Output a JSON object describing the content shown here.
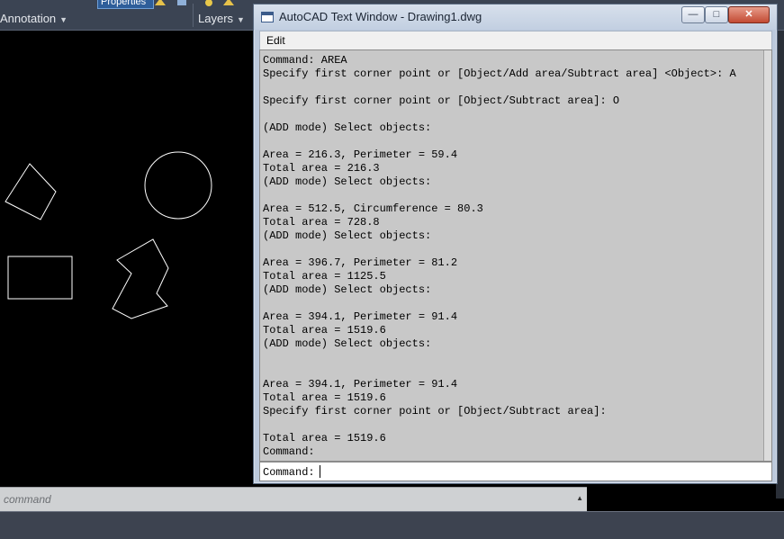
{
  "ribbon": {
    "annotation_label": "Annotation",
    "layers_label": "Layers",
    "properties_button": "Properties",
    "dropdown_caret": "▼"
  },
  "text_window": {
    "title": "AutoCAD Text Window - Drawing1.dwg",
    "minimize_glyph": "—",
    "maximize_glyph": "□",
    "close_glyph": "✕",
    "menu": {
      "edit_label": "Edit"
    },
    "lines": [
      "Command: AREA",
      "Specify first corner point or [Object/Add area/Subtract area] <Object>: A",
      "",
      "Specify first corner point or [Object/Subtract area]: O",
      "",
      "(ADD mode) Select objects:",
      "",
      "Area = 216.3, Perimeter = 59.4",
      "Total area = 216.3",
      "(ADD mode) Select objects:",
      "",
      "Area = 512.5, Circumference = 80.3",
      "Total area = 728.8",
      "(ADD mode) Select objects:",
      "",
      "Area = 396.7, Perimeter = 81.2",
      "Total area = 1125.5",
      "(ADD mode) Select objects:",
      "",
      "Area = 394.1, Perimeter = 91.4",
      "Total area = 1519.6",
      "(ADD mode) Select objects:",
      "",
      "",
      "Area = 394.1, Perimeter = 91.4",
      "Total area = 1519.6",
      "Specify first corner point or [Object/Subtract area]:",
      "",
      "Total area = 1519.6",
      "Command:"
    ],
    "input_prompt": "Command: "
  },
  "command_line": {
    "placeholder": "command",
    "expand_glyph": "▲"
  },
  "colors": {
    "canvas_bg": "#000000",
    "geometry_stroke": "#ffffff",
    "ribbon_bg": "#3b4453",
    "text_window_bg": "#c8c8c8"
  },
  "icons": [
    "app-icon",
    "minimize-icon",
    "maximize-icon",
    "close-icon",
    "caret-down-icon",
    "expand-up-icon"
  ]
}
